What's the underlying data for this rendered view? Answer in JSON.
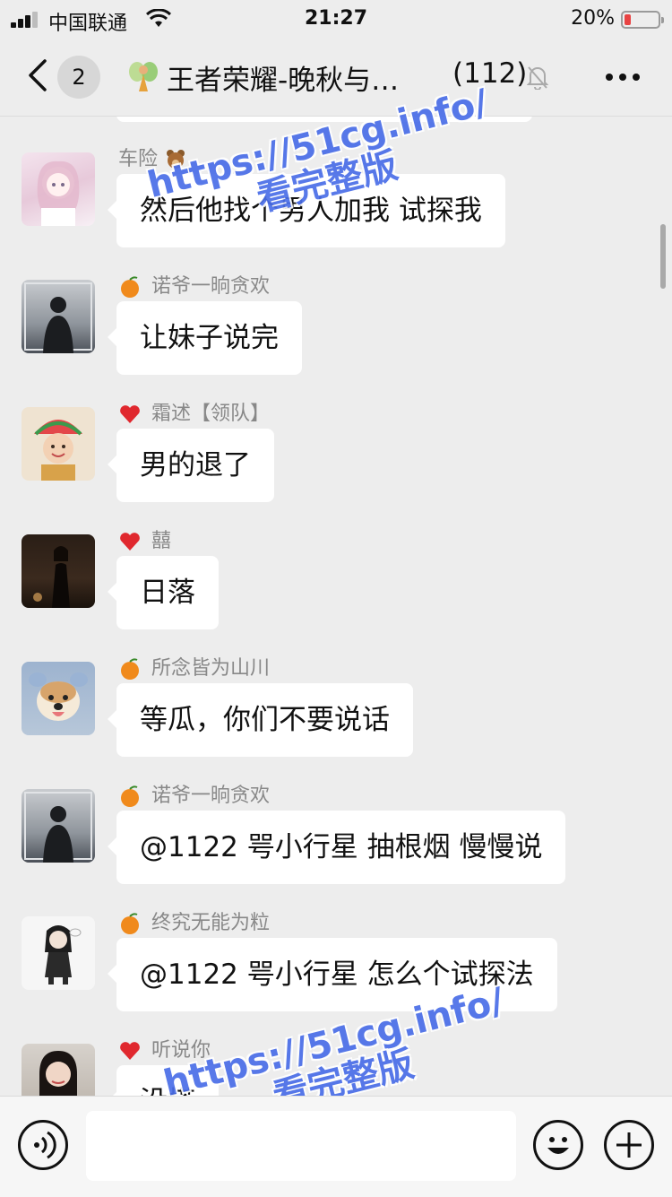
{
  "status_bar": {
    "carrier": "中国联通",
    "time": "21:27",
    "battery": "20%"
  },
  "nav": {
    "unread_count": "2",
    "title": "王者荣耀-晚秋与…",
    "member_count": "(112)"
  },
  "messages": [
    {
      "sender": "车险",
      "badge": "bear-icon",
      "text": "然后他找个男人加我 试探我",
      "avatar": "avatar-anime-girl"
    },
    {
      "sender": "诺爷一晌贪欢",
      "badge": "orange-icon",
      "text": "让妹子说完",
      "avatar": "avatar-man-silhouette"
    },
    {
      "sender": "霜述【领队】",
      "badge": "heart-icon",
      "text": "男的退了",
      "avatar": "avatar-girl-watermelon-hat"
    },
    {
      "sender": "囍",
      "badge": "heart-icon",
      "text": "日落",
      "avatar": "avatar-woman-dark"
    },
    {
      "sender": "所念皆为山川",
      "badge": "orange-icon",
      "text": "等瓜，你们不要说话",
      "avatar": "avatar-dog"
    },
    {
      "sender": "诺爷一晌贪欢",
      "badge": "orange-icon",
      "text": "@1122 咢小行星 抽根烟 慢慢说",
      "avatar": "avatar-man-silhouette"
    },
    {
      "sender": "终究无能为粒",
      "badge": "orange-icon",
      "text": "@1122 咢小行星 怎么个试探法",
      "avatar": "avatar-cartoon-girl"
    },
    {
      "sender": "听说你",
      "badge": "heart-icon",
      "text": "没搭",
      "avatar": "avatar-girl-portrait"
    }
  ],
  "watermarks": [
    {
      "line1": "https://51cg.info/",
      "line2": "看完整版"
    },
    {
      "line1": "https://51cg.info/",
      "line2": "看完整版"
    }
  ],
  "input": {
    "value": "",
    "placeholder": ""
  },
  "colors": {
    "background": "#ededed",
    "bubble": "#ffffff",
    "watermark": "#4a6ee8"
  }
}
